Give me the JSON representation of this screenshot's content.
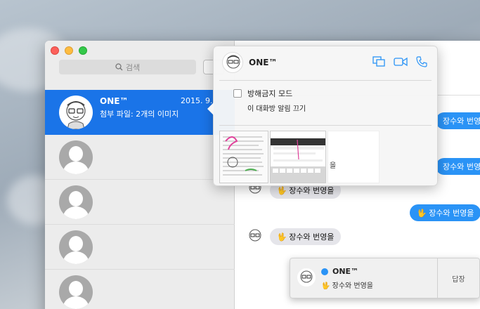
{
  "sidebar": {
    "search_placeholder": "검색",
    "conversations": [
      {
        "name": "ONE™",
        "date": "2015. 9.",
        "preview": "첨부 파일: 2개의 이미지"
      }
    ]
  },
  "popover": {
    "contact_name": "ONE™",
    "dnd_label": "방해금지 모드",
    "dnd_sublabel": "이 대화방 알림 끄기",
    "attachment_caption": "을",
    "actions": [
      "screen-share-icon",
      "video-call-icon",
      "phone-call-icon"
    ]
  },
  "messages": [
    {
      "side": "out",
      "text": "장수와 번영을"
    },
    {
      "side": "out",
      "text": "장수와 번영을"
    },
    {
      "side": "in",
      "text": "🖖 장수와 번영을"
    },
    {
      "side": "out",
      "text": "🖖 장수와 번영을"
    },
    {
      "side": "in",
      "text": "🖖 장수와 번영을"
    }
  ],
  "notification": {
    "title": "ONE™",
    "body": "🖖 장수와 번영을",
    "reply_label": "답장"
  },
  "colors": {
    "accent": "#1a74e8",
    "bubble_out": "#2a93f6",
    "bubble_in": "#e5e5ea"
  }
}
